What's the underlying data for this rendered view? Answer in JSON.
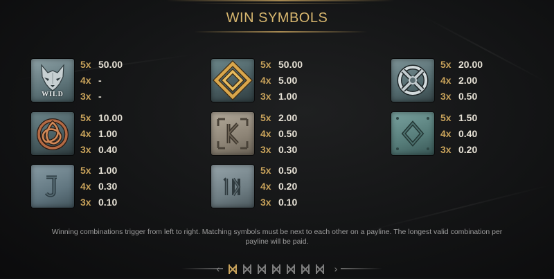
{
  "header": {
    "title": "WIN SYMBOLS"
  },
  "symbols": [
    {
      "icon": "wolf-wild-icon",
      "label": "WILD",
      "pays": [
        [
          "5x",
          "50.00"
        ],
        [
          "4x",
          "-"
        ],
        [
          "3x",
          "-"
        ]
      ]
    },
    {
      "icon": "gold-knot-icon",
      "pays": [
        [
          "5x",
          "50.00"
        ],
        [
          "4x",
          "5.00"
        ],
        [
          "3x",
          "1.00"
        ]
      ]
    },
    {
      "icon": "silver-circle-knot-icon",
      "pays": [
        [
          "5x",
          "20.00"
        ],
        [
          "4x",
          "2.00"
        ],
        [
          "3x",
          "0.50"
        ]
      ]
    },
    {
      "icon": "bronze-triquetra-icon",
      "pays": [
        [
          "5x",
          "10.00"
        ],
        [
          "4x",
          "1.00"
        ],
        [
          "3x",
          "0.40"
        ]
      ]
    },
    {
      "icon": "rune-k-stone-icon",
      "pays": [
        [
          "5x",
          "2.00"
        ],
        [
          "4x",
          "0.50"
        ],
        [
          "3x",
          "0.30"
        ]
      ]
    },
    {
      "icon": "rune-diamond-stone-icon",
      "pays": [
        [
          "5x",
          "1.50"
        ],
        [
          "4x",
          "0.40"
        ],
        [
          "3x",
          "0.20"
        ]
      ]
    },
    {
      "icon": "rune-j-stone-icon",
      "pays": [
        [
          "5x",
          "1.00"
        ],
        [
          "4x",
          "0.30"
        ],
        [
          "3x",
          "0.10"
        ]
      ]
    },
    {
      "icon": "rune-10-stone-icon",
      "pays": [
        [
          "5x",
          "0.50"
        ],
        [
          "4x",
          "0.20"
        ],
        [
          "3x",
          "0.10"
        ]
      ]
    }
  ],
  "footnote": {
    "line1": "Winning combinations trigger from left to right. Matching symbols must be next to each other on a payline. The longest valid combination per",
    "line2": "payline will be paid."
  },
  "pager": {
    "pages": 7,
    "active_page": 1,
    "active_color": "#c9a35b",
    "inactive_color": "#7d7d7d"
  }
}
